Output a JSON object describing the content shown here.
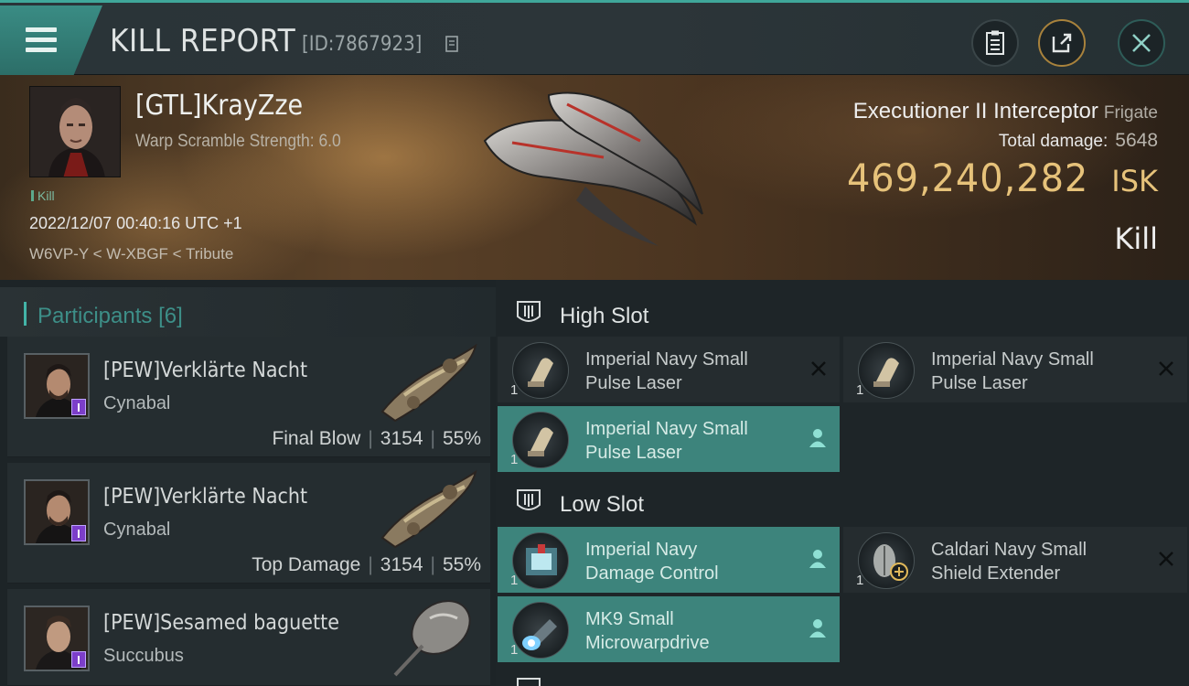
{
  "header": {
    "title": "KILL REPORT",
    "report_id": "[ID:7867923]"
  },
  "hero": {
    "pilot_name": "[GTL]KrayZze",
    "warp_scramble": "Warp Scramble Strength: 6.0",
    "kill_tag": "Kill",
    "datetime": "2022/12/07 00:40:16 UTC +1",
    "location": "W6VP-Y < W-XBGF < Tribute",
    "ship_name": "Executioner II Interceptor",
    "ship_class": "Frigate",
    "total_damage_label": "Total damage:",
    "total_damage_value": "5648",
    "isk_value": "469,240,282",
    "isk_unit": "ISK",
    "result": "Kill"
  },
  "participants": {
    "label": "Participants",
    "count": "[6]",
    "rows": [
      {
        "name": "[PEW]Verklärte Nacht",
        "ship": "Cynabal",
        "role": "Final Blow",
        "damage": "3154",
        "percent": "55%"
      },
      {
        "name": "[PEW]Verklärte Nacht",
        "ship": "Cynabal",
        "role": "Top Damage",
        "damage": "3154",
        "percent": "55%"
      },
      {
        "name": "[PEW]Sesamed baguette",
        "ship": "Succubus",
        "role": "",
        "damage": "",
        "percent": ""
      }
    ]
  },
  "fitting": {
    "high_slot": {
      "label": "High Slot",
      "modules": [
        {
          "line1": "Imperial Navy Small",
          "line2": "Pulse Laser",
          "qty": "1",
          "status": "destroyed"
        },
        {
          "line1": "Imperial Navy Small",
          "line2": "Pulse Laser",
          "qty": "1",
          "status": "destroyed"
        },
        {
          "line1": "Imperial Navy Small",
          "line2": "Pulse Laser",
          "qty": "1",
          "status": "dropped"
        }
      ]
    },
    "low_slot": {
      "label": "Low Slot",
      "modules": [
        {
          "line1": "Imperial Navy",
          "line2": "Damage Control",
          "qty": "1",
          "status": "dropped"
        },
        {
          "line1": "Caldari Navy Small",
          "line2": "Shield Extender",
          "qty": "1",
          "status": "destroyed"
        },
        {
          "line1": "MK9 Small",
          "line2": "Microwarpdrive",
          "qty": "1",
          "status": "dropped"
        }
      ]
    }
  },
  "colors": {
    "accent_teal": "#3d847c",
    "isk_gold": "#e6c27a",
    "badge_purple": "#7c3ec9"
  }
}
